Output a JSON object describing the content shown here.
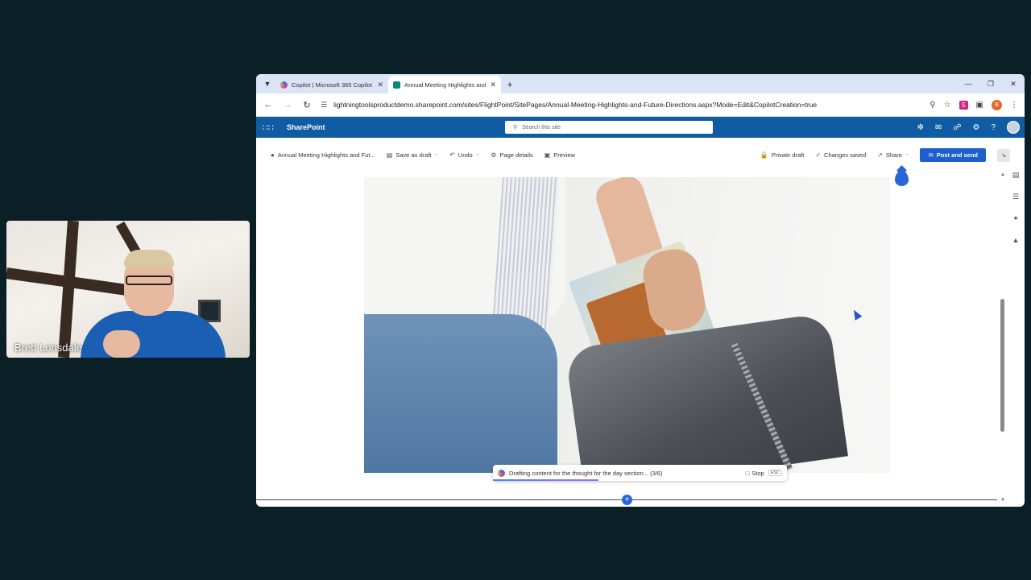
{
  "webcam": {
    "participant_name": "Brett Lonsdale"
  },
  "browser": {
    "tabs": [
      {
        "label": "Copilot | Microsoft 365 Copilot",
        "active": false
      },
      {
        "label": "Annual Meeting Highlights and Fu",
        "active": true
      }
    ],
    "new_tab_icon": "+",
    "url": "lightningtoolsproductdemo.sharepoint.com/sites/FlightPoint/SitePages/Annual-Meeting-Highlights-and-Future-Directions.aspx?Mode=Edit&CopilotCreation=true",
    "profile_initial": "B",
    "extension_label": "S"
  },
  "suite": {
    "brand": "SharePoint",
    "search_placeholder": "Search this site"
  },
  "commandbar": {
    "page_title": "Annual Meeting Highlights and Fut...",
    "save_as_draft": "Save as draft",
    "undo": "Undo",
    "page_details": "Page details",
    "preview": "Preview",
    "private_draft": "Private draft",
    "changes_saved": "Changes saved",
    "share": "Share",
    "post_and_send": "Post and send"
  },
  "copilot_status": {
    "text": "Drafting content for the thought for the day section... (3/6)",
    "stop_label": "Stop",
    "esc_label": "ESC",
    "progress": 0.36
  },
  "colors": {
    "suite_bar": "#0f5ca3",
    "primary_button": "#1d5fcf",
    "accent": "#2865d6"
  }
}
